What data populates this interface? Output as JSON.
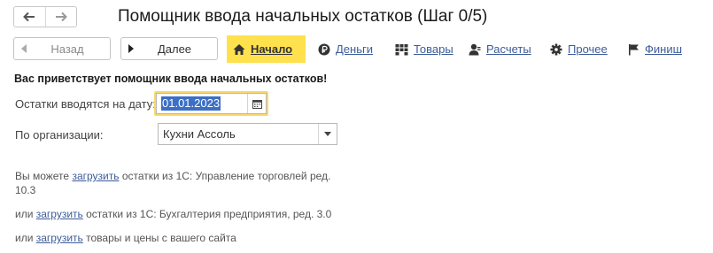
{
  "window": {
    "title": "Помощник ввода начальных остатков (Шаг 0/5)",
    "nav_back_icon": "arrow-left-icon",
    "nav_forward_icon": "arrow-right-icon"
  },
  "toolbar": {
    "back_label": "Назад",
    "next_label": "Далее",
    "steps": [
      {
        "label": "Начало",
        "icon": "home-icon",
        "active": true
      },
      {
        "label": "Деньги",
        "icon": "ruble-icon"
      },
      {
        "label": "Товары",
        "icon": "boxes-icon"
      },
      {
        "label": "Расчеты",
        "icon": "person-icon"
      },
      {
        "label": "Прочее",
        "icon": "gear-icon"
      },
      {
        "label": "Финиш",
        "icon": "flag-icon"
      }
    ]
  },
  "main": {
    "welcome": "Вас приветствует помощник ввода начальных остатков!",
    "date_label": "Остатки вводятся на дату:",
    "date_value": "01.01.2023",
    "org_label": "По организации:",
    "org_value": "Кухни Ассоль",
    "load1": {
      "prefix": "Вы можете ",
      "link": "загрузить",
      "line1": " остатки из 1С: Управление торговлей ред.",
      "line2": "10.3"
    },
    "load2": {
      "prefix": "или ",
      "link": "загрузить",
      "suffix": " остатки из 1С: Бухгалтерия предприятия, ред. 3.0"
    },
    "load3": {
      "prefix": "или ",
      "link": "загрузить",
      "suffix": " товары и цены с вашего сайта"
    }
  },
  "colors": {
    "accent_active_step": "#ffe14d",
    "link": "#3d5c99",
    "date_focus": "#f8d96a",
    "selection": "#3c6fc6"
  }
}
